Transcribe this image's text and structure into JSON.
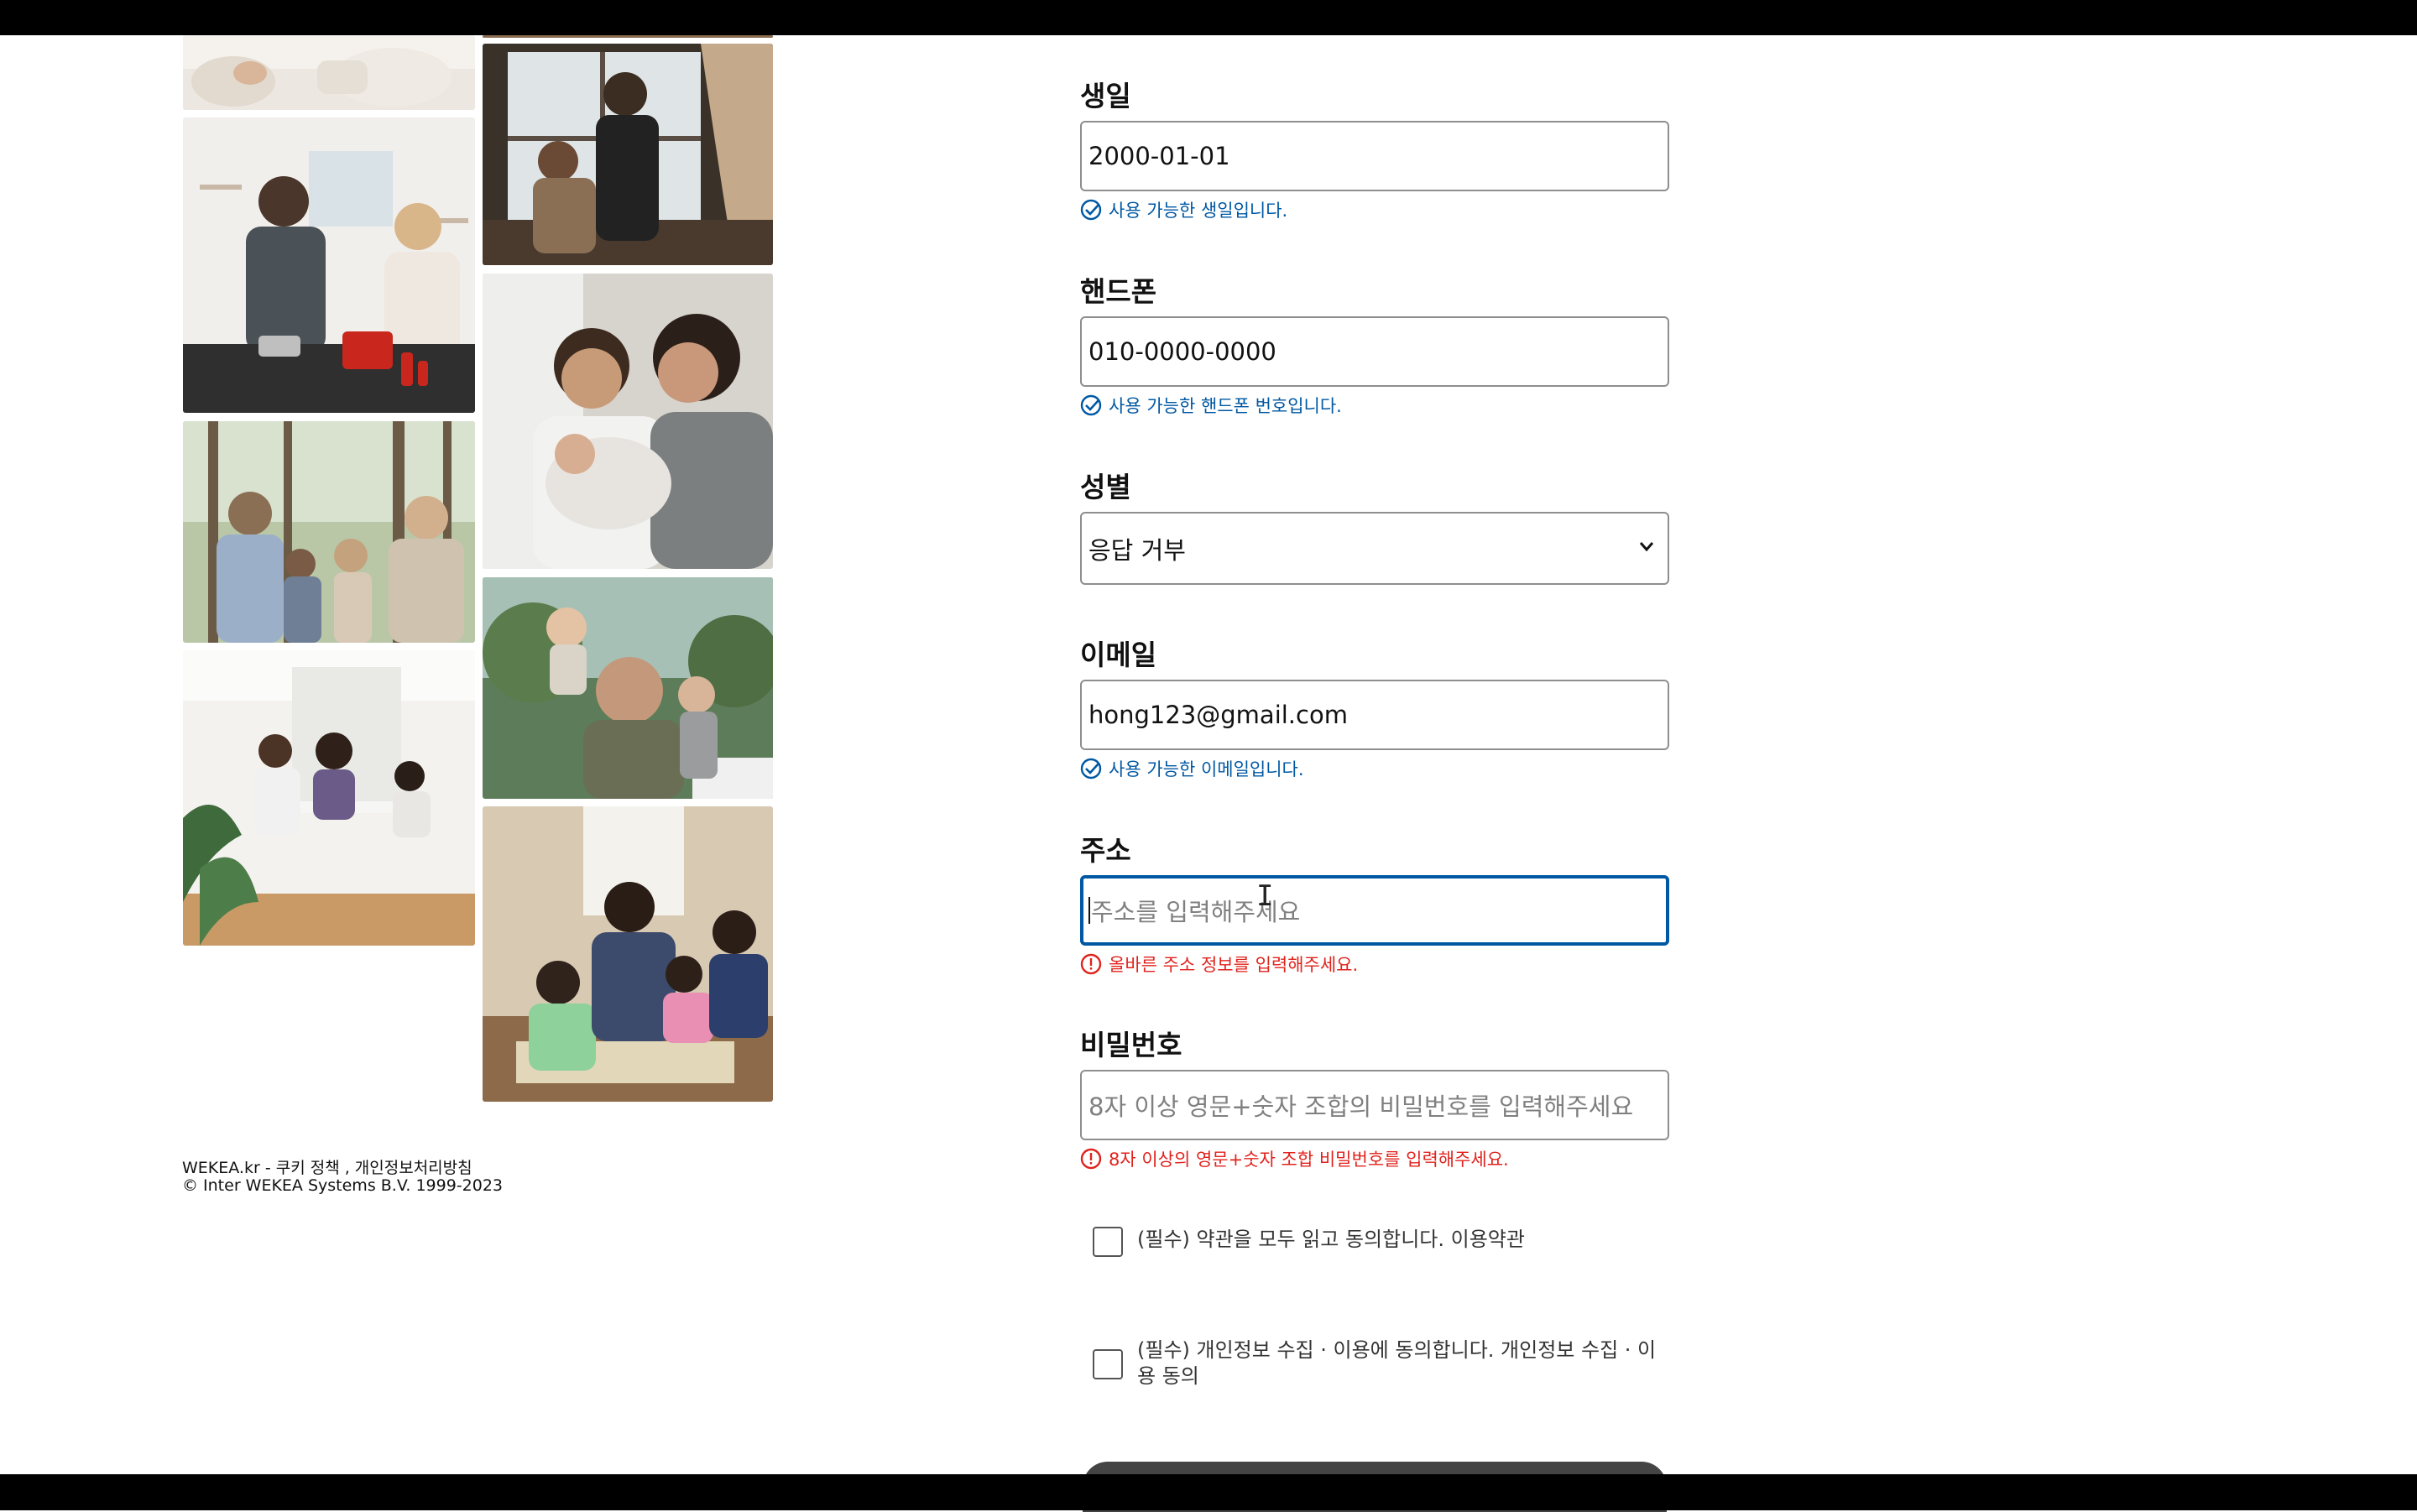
{
  "gallery": {
    "photos": [
      {
        "name": "photo-living-room-feet",
        "desc_icon": "family-photo-icon"
      },
      {
        "name": "photo-kids-at-window",
        "desc_icon": "family-photo-icon"
      },
      {
        "name": "photo-couple-cooking",
        "desc_icon": "family-photo-icon"
      },
      {
        "name": "photo-parents-newborn",
        "desc_icon": "family-photo-icon"
      },
      {
        "name": "photo-family-forest-walk",
        "desc_icon": "family-photo-icon"
      },
      {
        "name": "photo-father-with-kids-outdoors",
        "desc_icon": "family-photo-icon"
      },
      {
        "name": "photo-family-dining",
        "desc_icon": "family-photo-icon"
      },
      {
        "name": "photo-family-board-game",
        "desc_icon": "family-photo-icon"
      }
    ]
  },
  "footer": {
    "line1": "WEKEA.kr - 쿠키 정책 , 개인정보처리방침",
    "line2": "© Inter WEKEA Systems B.V. 1999-2023"
  },
  "form": {
    "birthday": {
      "label": "생일",
      "value": "2000-01-01",
      "message": "사용 가능한 생일입니다."
    },
    "phone": {
      "label": "핸드폰",
      "value": "010-0000-0000",
      "message": "사용 가능한 핸드폰 번호입니다."
    },
    "gender": {
      "label": "성별",
      "selected": "응답 거부"
    },
    "email": {
      "label": "이메일",
      "value": "hong123@gmail.com",
      "message": "사용 가능한 이메일입니다."
    },
    "address": {
      "label": "주소",
      "placeholder": "주소를 입력해주세요",
      "error": "올바른 주소 정보를 입력해주세요."
    },
    "password": {
      "label": "비밀번호",
      "placeholder": "8자 이상 영문+숫자 조합의 비밀번호를 입력해주세요",
      "error": "8자 이상의 영문+숫자 조합 비밀번호를 입력해주세요."
    },
    "agree_terms": "(필수) 약관을 모두 읽고 동의합니다. 이용약관",
    "agree_privacy": "(필수) 개인정보 수집 · 이용에 동의합니다. 개인정보 수집 · 이용 동의"
  },
  "colors": {
    "accent": "#0058a3",
    "error": "#e0231d",
    "border": "#8e8e8e"
  }
}
